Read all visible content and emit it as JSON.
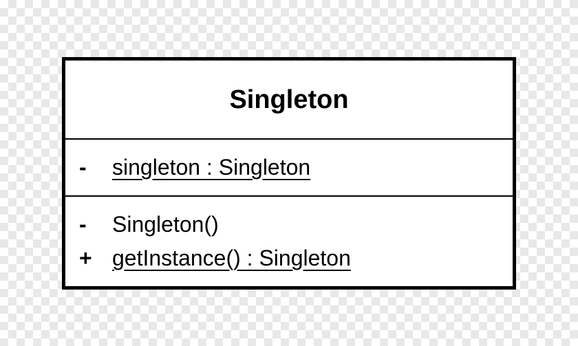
{
  "uml": {
    "className": "Singleton",
    "attributes": [
      {
        "visibility": "-",
        "text": "singleton : Singleton",
        "static": true
      }
    ],
    "methods": [
      {
        "visibility": "-",
        "text": "Singleton()",
        "static": false
      },
      {
        "visibility": "+",
        "text": "getInstance() : Singleton",
        "static": true
      }
    ]
  }
}
